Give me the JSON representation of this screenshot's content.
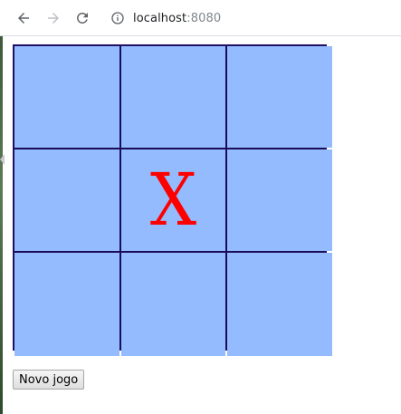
{
  "browser": {
    "url_host": "localhost",
    "url_port": ":8080",
    "icons": [
      "back-arrow-icon",
      "forward-arrow-icon",
      "reload-icon",
      "info-icon"
    ]
  },
  "board": {
    "cells": [
      "",
      "",
      "",
      "",
      "X",
      "",
      "",
      "",
      ""
    ]
  },
  "controls": {
    "new_game_label": "Novo jogo"
  },
  "colors": {
    "cell_bg": "#94bbfd",
    "grid_lines": "#1a0c5a",
    "mark": "#ff0000"
  }
}
